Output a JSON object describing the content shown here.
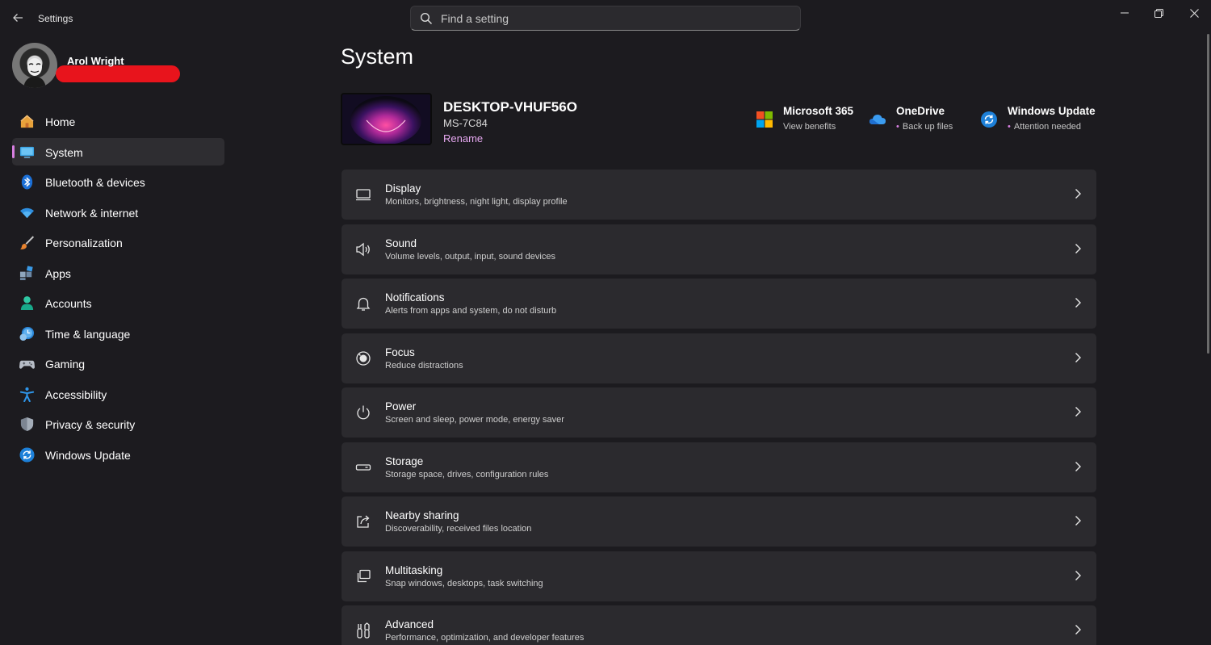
{
  "app": {
    "title": "Settings"
  },
  "search": {
    "placeholder": "Find a setting"
  },
  "user": {
    "name": "Arol Wright"
  },
  "nav": {
    "items": [
      {
        "label": "Home",
        "icon": "home-icon"
      },
      {
        "label": "System",
        "icon": "monitor-icon",
        "selected": true
      },
      {
        "label": "Bluetooth & devices",
        "icon": "bluetooth-icon"
      },
      {
        "label": "Network & internet",
        "icon": "wifi-icon"
      },
      {
        "label": "Personalization",
        "icon": "brush-icon"
      },
      {
        "label": "Apps",
        "icon": "apps-icon"
      },
      {
        "label": "Accounts",
        "icon": "person-icon"
      },
      {
        "label": "Time & language",
        "icon": "globe-clock-icon"
      },
      {
        "label": "Gaming",
        "icon": "gamepad-icon"
      },
      {
        "label": "Accessibility",
        "icon": "accessibility-icon"
      },
      {
        "label": "Privacy & security",
        "icon": "shield-icon"
      },
      {
        "label": "Windows Update",
        "icon": "update-icon"
      }
    ]
  },
  "page": {
    "title": "System"
  },
  "device": {
    "name": "DESKTOP-VHUF56O",
    "model": "MS-7C84",
    "rename_label": "Rename"
  },
  "quick_links": [
    {
      "title": "Microsoft 365",
      "subtitle": "View benefits",
      "icon": "microsoft-logo-icon",
      "dot": false
    },
    {
      "title": "OneDrive",
      "subtitle": "Back up files",
      "icon": "cloud-icon",
      "dot": true
    },
    {
      "title": "Windows Update",
      "subtitle": "Attention needed",
      "icon": "update-icon",
      "dot": true
    }
  ],
  "cards": [
    {
      "title": "Display",
      "subtitle": "Monitors, brightness, night light, display profile",
      "icon": "display-icon"
    },
    {
      "title": "Sound",
      "subtitle": "Volume levels, output, input, sound devices",
      "icon": "speaker-icon"
    },
    {
      "title": "Notifications",
      "subtitle": "Alerts from apps and system, do not disturb",
      "icon": "bell-icon"
    },
    {
      "title": "Focus",
      "subtitle": "Reduce distractions",
      "icon": "focus-icon"
    },
    {
      "title": "Power",
      "subtitle": "Screen and sleep, power mode, energy saver",
      "icon": "power-icon"
    },
    {
      "title": "Storage",
      "subtitle": "Storage space, drives, configuration rules",
      "icon": "storage-icon"
    },
    {
      "title": "Nearby sharing",
      "subtitle": "Discoverability, received files location",
      "icon": "share-icon"
    },
    {
      "title": "Multitasking",
      "subtitle": "Snap windows, desktops, task switching",
      "icon": "multitask-icon"
    },
    {
      "title": "Advanced",
      "subtitle": "Performance, optimization, and developer features",
      "icon": "tools-icon"
    }
  ],
  "colors": {
    "background": "#1c1b1f",
    "card": "#2b2a2e",
    "accent": "#d77fe0",
    "redaction": "#e8141c"
  }
}
